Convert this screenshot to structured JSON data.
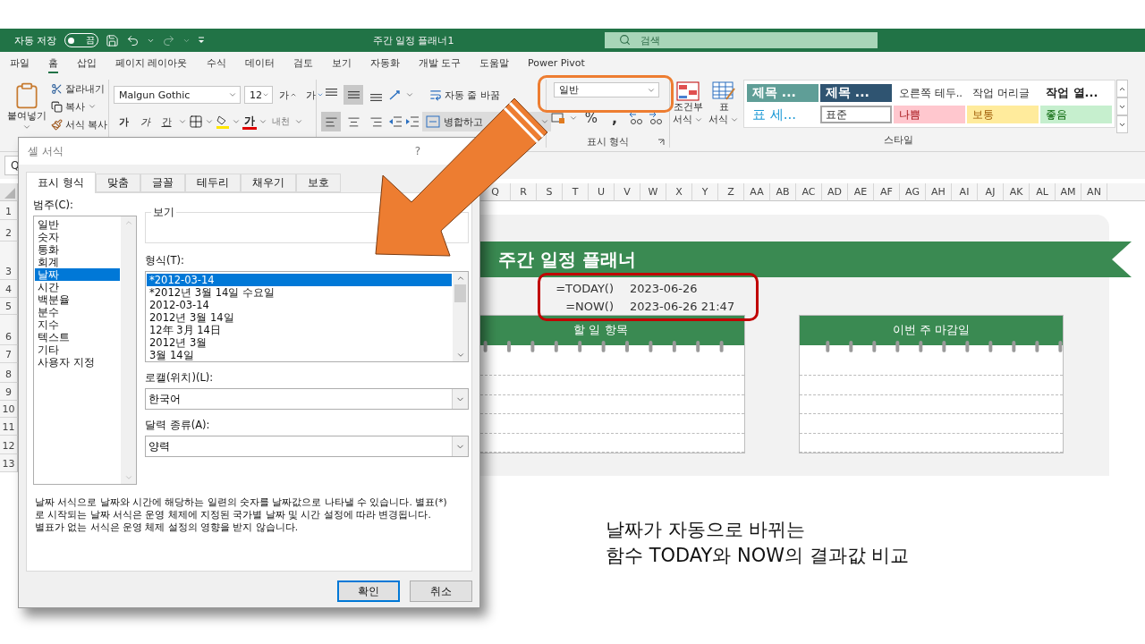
{
  "title_bar": {
    "autosave_label": "자동 저장",
    "autosave_toggle": {
      "label": "끔",
      "on": false
    },
    "title": "주간 일정 플래너1",
    "search": {
      "placeholder": "검색"
    }
  },
  "ribbon_tabs": [
    {
      "label": "파일",
      "selected": false
    },
    {
      "label": "홈",
      "selected": true
    },
    {
      "label": "삽입",
      "selected": false
    },
    {
      "label": "페이지 레이아웃",
      "selected": false
    },
    {
      "label": "수식",
      "selected": false
    },
    {
      "label": "데이터",
      "selected": false
    },
    {
      "label": "검토",
      "selected": false
    },
    {
      "label": "보기",
      "selected": false
    },
    {
      "label": "자동화",
      "selected": false
    },
    {
      "label": "개발 도구",
      "selected": false
    },
    {
      "label": "도움말",
      "selected": false
    },
    {
      "label": "Power Pivot",
      "selected": false
    }
  ],
  "ribbon": {
    "clipboard": {
      "paste": "붙여넣기",
      "cut": "잘라내기",
      "copy": "복사",
      "format_painter": "서식 복사"
    },
    "font": {
      "font_name": "Malgun Gothic",
      "font_size": "12",
      "grow": "가",
      "shrink": "가",
      "bold": "가",
      "italic": "가",
      "underline": "간",
      "font_color": "가",
      "phonetic": "내천"
    },
    "alignment": {
      "wrap_text": "자동 줄 바꿈",
      "merge": "병합하고"
    },
    "number": {
      "format": "일반",
      "percent": "%",
      "comma": ",",
      "label": "표시 형식"
    },
    "styles": {
      "conditional_formatting": [
        "조건부",
        "서식"
      ],
      "format_as_table": [
        "표",
        "서식"
      ],
      "label": "스타일",
      "gallery": [
        {
          "label": "제목 ...",
          "kind": "heading1",
          "selected": false
        },
        {
          "label": "제목 ...",
          "kind": "heading2",
          "selected": false
        },
        {
          "label": "오른쪽 테두...",
          "kind": "plain",
          "selected": false
        },
        {
          "label": "작업 머리글",
          "kind": "plain",
          "selected": false
        },
        {
          "label": "작업 열...",
          "kind": "bold",
          "selected": false
        },
        {
          "label": "표 세...",
          "kind": "title",
          "selected": false
        },
        {
          "label": "표준",
          "kind": "normal",
          "selected": true
        },
        {
          "label": "나쁨",
          "kind": "bad",
          "selected": false
        },
        {
          "label": "보통",
          "kind": "neutral",
          "selected": false
        },
        {
          "label": "좋음",
          "kind": "good",
          "selected": false
        }
      ]
    }
  },
  "formula_bar": {
    "name_box": "Q"
  },
  "sheet": {
    "columns": [
      "Q",
      "R",
      "S",
      "T",
      "U",
      "V",
      "W",
      "X",
      "Y",
      "Z",
      "AA",
      "AB",
      "AC",
      "AD",
      "AE",
      "AF",
      "AG",
      "AH",
      "AI",
      "AJ",
      "AK",
      "AL",
      "AM",
      "AN"
    ],
    "rows": [
      "1",
      "2",
      "3",
      "4",
      "5",
      "6",
      "7",
      "8",
      "9",
      "10",
      "11",
      "12",
      "13"
    ],
    "planner": {
      "title": "주간 일정 플래너",
      "formulas": [
        {
          "formula": "=TODAY()",
          "result": "2023-06-26"
        },
        {
          "formula": "=NOW()",
          "result": "2023-06-26 21:47"
        }
      ],
      "panels": [
        {
          "title": "할 일 항목"
        },
        {
          "title": "이번 주 마감일"
        }
      ]
    }
  },
  "dialog": {
    "title": "셀 서식",
    "help": "?",
    "tabs": [
      {
        "label": "표시 형식",
        "selected": true
      },
      {
        "label": "맞춤",
        "selected": false
      },
      {
        "label": "글꼴",
        "selected": false
      },
      {
        "label": "테두리",
        "selected": false
      },
      {
        "label": "채우기",
        "selected": false
      },
      {
        "label": "보호",
        "selected": false
      }
    ],
    "category_label": "범주(C):",
    "categories": [
      {
        "label": "일반",
        "selected": false
      },
      {
        "label": "숫자",
        "selected": false
      },
      {
        "label": "통화",
        "selected": false
      },
      {
        "label": "회계",
        "selected": false
      },
      {
        "label": "날짜",
        "selected": true
      },
      {
        "label": "시간",
        "selected": false
      },
      {
        "label": "백분율",
        "selected": false
      },
      {
        "label": "분수",
        "selected": false
      },
      {
        "label": "지수",
        "selected": false
      },
      {
        "label": "텍스트",
        "selected": false
      },
      {
        "label": "기타",
        "selected": false
      },
      {
        "label": "사용자 지정",
        "selected": false
      }
    ],
    "sample_label": "보기",
    "type_label": "형식(T):",
    "types": [
      {
        "label": "*2012-03-14",
        "selected": true
      },
      {
        "label": "*2012년 3월 14일 수요일",
        "selected": false
      },
      {
        "label": "2012-03-14",
        "selected": false
      },
      {
        "label": "2012년 3월 14일",
        "selected": false
      },
      {
        "label": "12年 3月 14日",
        "selected": false
      },
      {
        "label": "2012년 3월",
        "selected": false
      },
      {
        "label": "3월 14일",
        "selected": false
      }
    ],
    "locale_label": "로캘(위치)(L):",
    "locale": "한국어",
    "calendar_label": "달력 종류(A):",
    "calendar": "양력",
    "description": [
      "날짜 서식으로 날짜와 시간에 해당하는 일련의 숫자를 날짜값으로 나타낼 수 있습니다. 별표(*)",
      "로 시작되는 날짜 서식은 운영 체제에 지정된 국가별 날짜 및 시간 설정에 따라 변경됩니다.",
      "별표가 없는 서식은 운영 체제 설정의 영향을 받지 않습니다."
    ],
    "buttons": [
      {
        "label": "확인",
        "default": true
      },
      {
        "label": "취소",
        "default": false
      }
    ]
  },
  "caption": [
    "날짜가 자동으로 바뀌는",
    "함수 TODAY와 NOW의 결과값 비교"
  ]
}
